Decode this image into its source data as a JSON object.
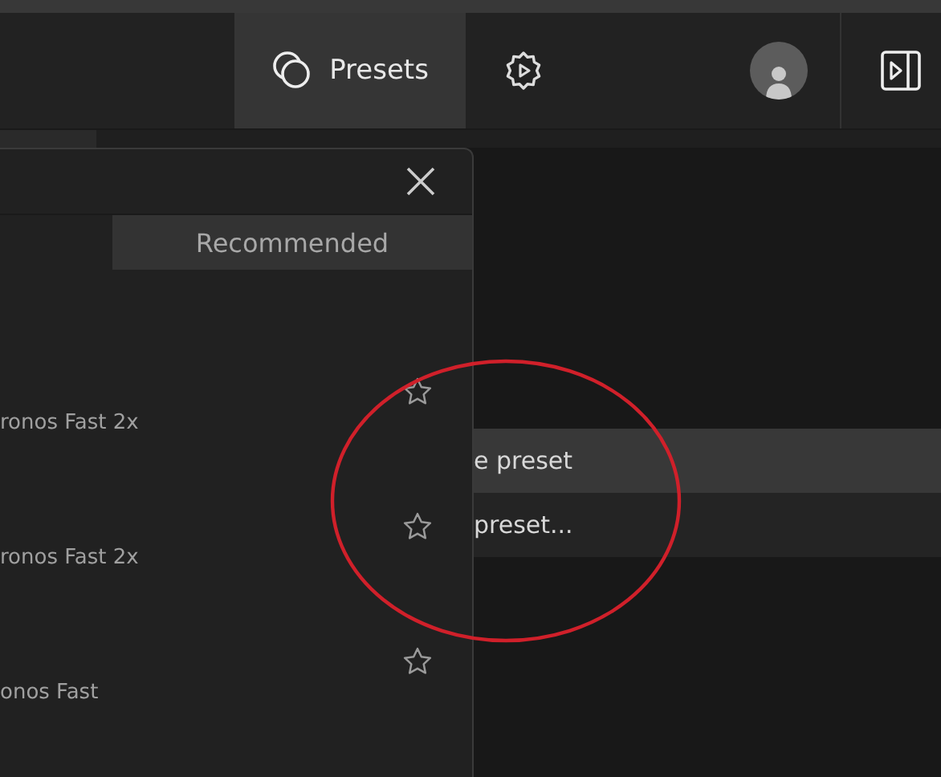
{
  "toolbar": {
    "presets_button": {
      "label": "Presets",
      "selected": true
    }
  },
  "panel": {
    "tabs": [
      {
        "label": "Recommended",
        "selected": true
      }
    ],
    "presets": [
      {
        "name": "ronos Fast 2x",
        "favorite": false
      },
      {
        "name": "ronos Fast 2x",
        "favorite": false
      },
      {
        "name": "onos Fast",
        "favorite": false
      }
    ]
  },
  "menu": {
    "items": [
      {
        "label": "e preset",
        "highlighted": true
      },
      {
        "label": "preset...",
        "highlighted": false
      }
    ]
  }
}
